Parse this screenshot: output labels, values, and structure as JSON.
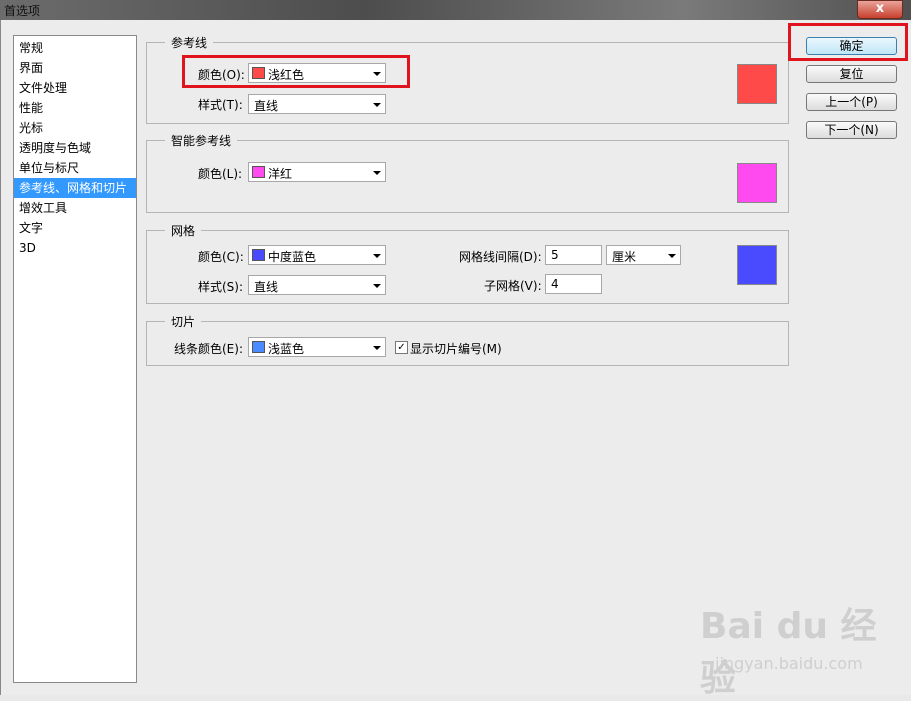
{
  "window": {
    "title": "首选项",
    "close_label": "x"
  },
  "sidebar": {
    "items": [
      {
        "label": "常规"
      },
      {
        "label": "界面"
      },
      {
        "label": "文件处理"
      },
      {
        "label": "性能"
      },
      {
        "label": "光标"
      },
      {
        "label": "透明度与色域"
      },
      {
        "label": "单位与标尺"
      },
      {
        "label": "参考线、网格和切片"
      },
      {
        "label": "增效工具"
      },
      {
        "label": "文字"
      },
      {
        "label": "3D"
      }
    ],
    "selected": "参考线、网格和切片"
  },
  "guides": {
    "title": "参考线",
    "color_label": "颜色(O):",
    "color_value": "浅红色",
    "color_hex": "#ff4a4a",
    "style_label": "样式(T):",
    "style_value": "直线"
  },
  "smart_guides": {
    "title": "智能参考线",
    "color_label": "颜色(L):",
    "color_value": "洋红",
    "color_hex": "#ff4af0"
  },
  "grid": {
    "title": "网格",
    "color_label": "颜色(C):",
    "color_value": "中度蓝色",
    "color_hex": "#4a4aff",
    "style_label": "样式(S):",
    "style_value": "直线",
    "gridline_label": "网格线间隔(D):",
    "gridline_value": "5",
    "unit_value": "厘米",
    "subdiv_label": "子网格(V):",
    "subdiv_value": "4"
  },
  "slices": {
    "title": "切片",
    "line_color_label": "线条颜色(E):",
    "line_color_value": "浅蓝色",
    "line_color_hex": "#4a8cff",
    "show_numbers_label": "显示切片编号(M)",
    "show_numbers_checked": true
  },
  "buttons": {
    "ok": "确定",
    "reset": "复位",
    "prev": "上一个(P)",
    "next": "下一个(N)"
  },
  "watermark": {
    "logo": "Bai du 经验",
    "url": "jingyan.baidu.com"
  }
}
